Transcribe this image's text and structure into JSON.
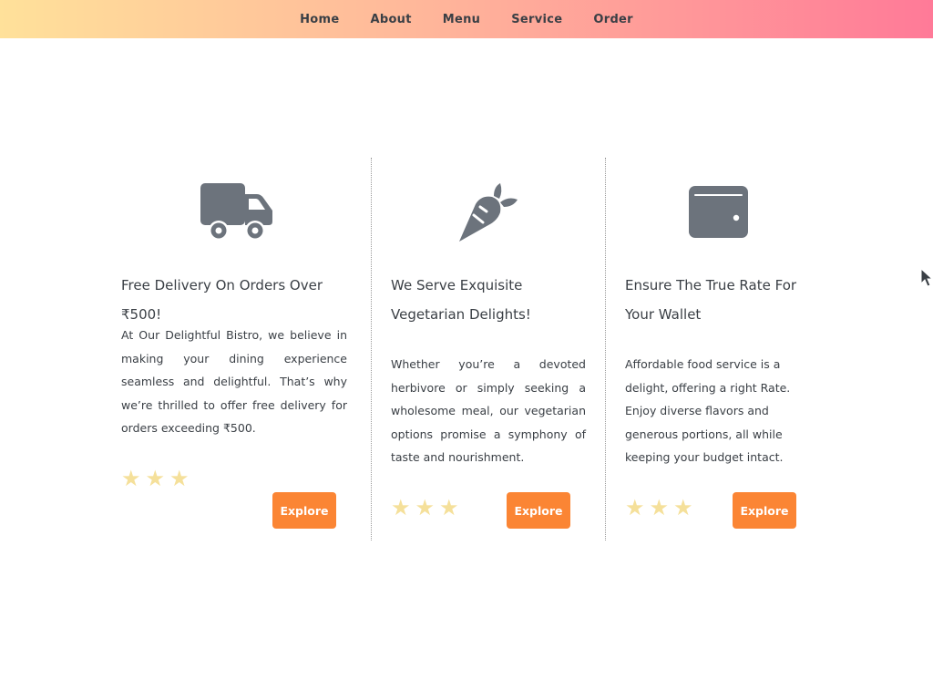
{
  "nav": {
    "items": [
      {
        "label": "Home"
      },
      {
        "label": "About"
      },
      {
        "label": "Menu"
      },
      {
        "label": "Service"
      },
      {
        "label": "Order"
      }
    ]
  },
  "cards": [
    {
      "icon": "truck-icon",
      "title": "Free Delivery On Orders Over ₹500!",
      "text": "At Our Delightful Bistro, we believe in making your dining experience seamless and delightful. That’s why we’re thrilled to offer free delivery for orders exceeding ₹500.",
      "rating": 3,
      "button_label": "Explore"
    },
    {
      "icon": "carrot-icon",
      "title": "We Serve Exquisite Vegetarian Delights!",
      "text": "Whether you’re a devoted herbivore or simply seeking a wholesome meal, our vegetarian options promise a symphony of taste and nourishment.",
      "rating": 3,
      "button_label": "Explore"
    },
    {
      "icon": "wallet-icon",
      "title": "Ensure The True Rate For Your Wallet",
      "text": "Affordable food service is a delight, offering a right Rate. Enjoy diverse flavors and generous portions, all while keeping your budget intact.",
      "rating": 3,
      "button_label": "Explore"
    }
  ],
  "colors": {
    "nav_gradient_start": "#ffe19a",
    "nav_gradient_end": "#ff7a98",
    "accent": "#fb8534",
    "star": "#f5e09a",
    "icon": "#6c737c",
    "text": "#3a3f45"
  }
}
